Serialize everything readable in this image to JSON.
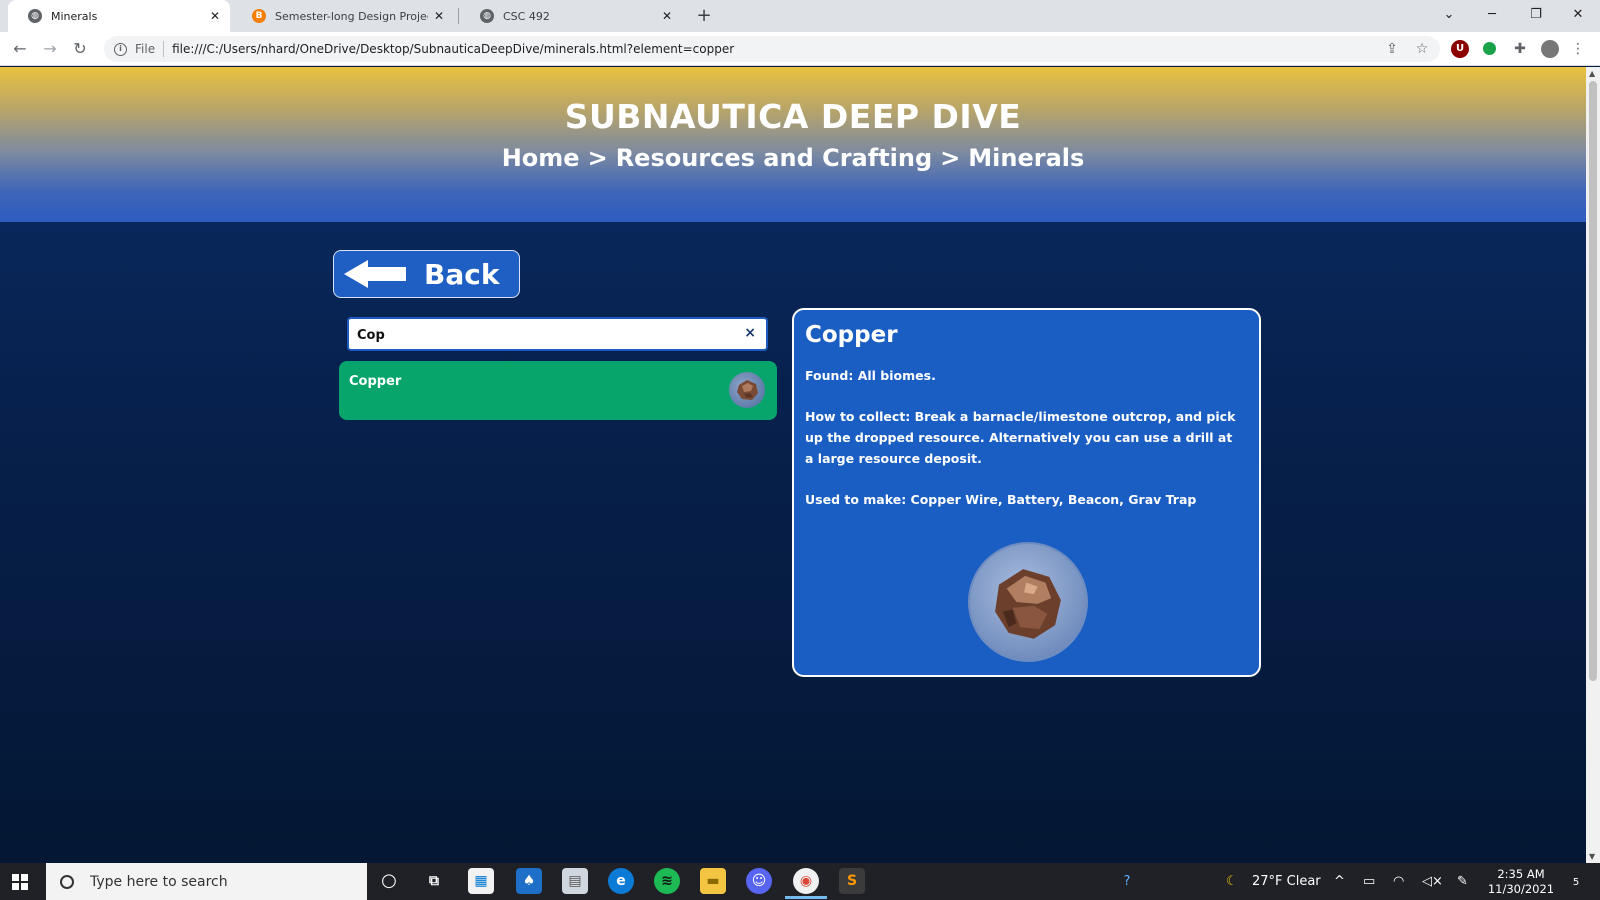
{
  "browser": {
    "tabs": [
      {
        "title": "Minerals",
        "active": true
      },
      {
        "title": "Semester-long Design Project - C",
        "active": false
      },
      {
        "title": "CSC 492",
        "active": false
      }
    ],
    "url_scheme": "File",
    "url": "file:///C:/Users/nhard/OneDrive/Desktop/SubnauticaDeepDive/minerals.html?element=copper"
  },
  "page": {
    "site_title": "SUBNAUTICA DEEP DIVE",
    "breadcrumb": [
      "Home",
      "Resources and Crafting",
      "Minerals"
    ],
    "breadcrumb_separator": ">",
    "back_label": "Back",
    "search": {
      "value": "Cop",
      "clear_icon": "×"
    },
    "results": [
      {
        "name": "Copper"
      }
    ],
    "detail": {
      "title": "Copper",
      "found": "Found: All biomes.",
      "how_to_collect": "How to collect: Break a barnacle/limestone outcrop, and pick up the dropped resource. Alternatively you can use a drill at a large resource deposit.",
      "used_to_make": "Used to make: Copper Wire, Battery, Beacon, Grav Trap"
    }
  },
  "taskbar": {
    "search_placeholder": "Type here to search",
    "weather": "27°F  Clear",
    "time": "2:35 AM",
    "date": "11/30/2021",
    "notification_count": "5"
  },
  "colors": {
    "header_top": "#e9c33e",
    "header_bottom": "#2d5cc0",
    "page_bg": "#07214e",
    "result_green": "#07a56c",
    "card_blue": "#1b5ec3"
  }
}
